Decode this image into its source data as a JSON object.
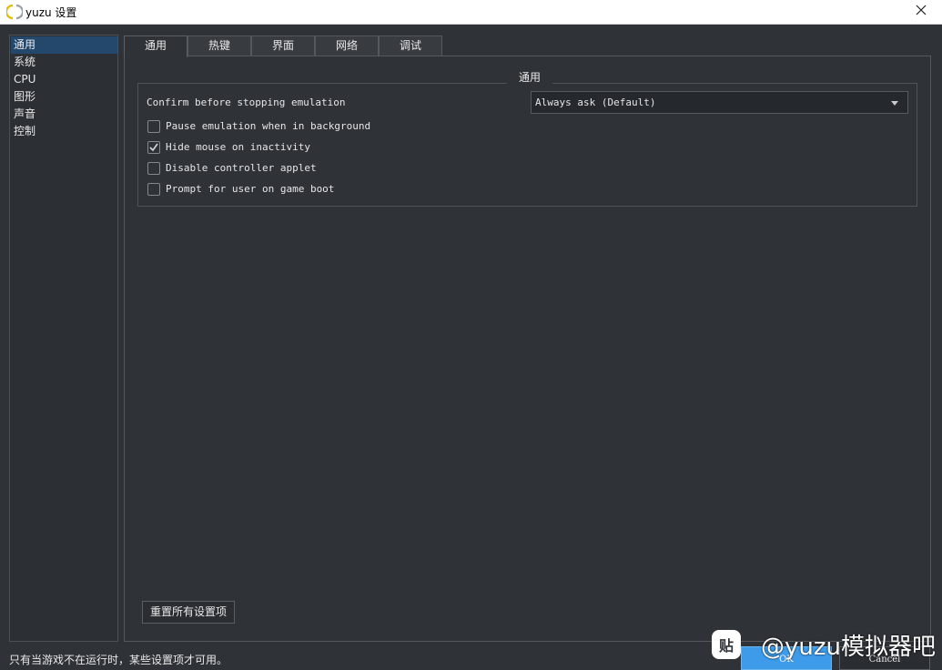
{
  "window": {
    "title": "yuzu 设置",
    "close_icon": "close-icon"
  },
  "colors": {
    "accent": "#3d9be9",
    "selected": "#24476c",
    "background": "#2f3338"
  },
  "sidebar": {
    "items": [
      {
        "label": "通用",
        "selected": true
      },
      {
        "label": "系统",
        "selected": false
      },
      {
        "label": "CPU",
        "selected": false
      },
      {
        "label": "图形",
        "selected": false
      },
      {
        "label": "声音",
        "selected": false
      },
      {
        "label": "控制",
        "selected": false
      }
    ]
  },
  "tabs": [
    {
      "label": "通用",
      "active": true
    },
    {
      "label": "热键",
      "active": false
    },
    {
      "label": "界面",
      "active": false
    },
    {
      "label": "网络",
      "active": false
    },
    {
      "label": "调试",
      "active": false
    }
  ],
  "general": {
    "group_title": "通用",
    "confirm_label": "Confirm before stopping emulation",
    "confirm_value": "Always ask (Default)",
    "options": [
      {
        "label": "Pause emulation when in background",
        "checked": false
      },
      {
        "label": "Hide mouse on inactivity",
        "checked": true
      },
      {
        "label": "Disable controller applet",
        "checked": false
      },
      {
        "label": "Prompt for user on game boot",
        "checked": false
      }
    ],
    "reset_label": "重置所有设置项"
  },
  "footer": {
    "status": "只有当游戏不在运行时，某些设置项才可用。",
    "ok_label": "OK",
    "cancel_label": "Cancel"
  },
  "watermark": {
    "logo_text": "贴",
    "text": "@yuzu模拟器吧"
  }
}
